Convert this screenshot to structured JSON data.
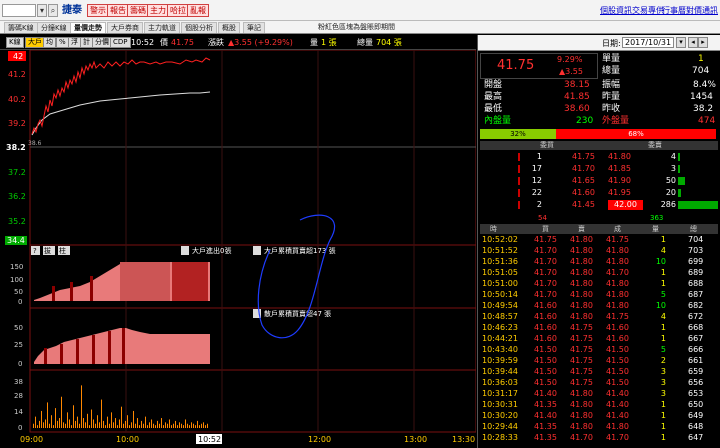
{
  "topbar": {
    "code_value": "",
    "stock_name": "捷泰",
    "buttons": [
      "警示",
      "報告",
      "籌碼",
      "主力",
      "哈拉",
      "亂報"
    ],
    "links": [
      "個股資訊",
      "交易專供",
      "行事曆",
      "對價通訊"
    ]
  },
  "tabs": [
    "籌碼K線",
    "分鐘K線",
    "量價走勢",
    "大戶券商",
    "主力軌道",
    "個股分析",
    "概股",
    "筆記"
  ],
  "tab_title": "粉紅色區塊為盤賬即期間",
  "toolbar": {
    "buttons": [
      "K線",
      "大戶",
      "均",
      "%",
      "浮",
      "計",
      "分價",
      "CDP"
    ],
    "time": "10:52",
    "price_label": "價",
    "price": "41.75",
    "change_label": "漲跌",
    "change": "▲3.55 (+9.29%)",
    "vol_label": "量",
    "vol": "1 張",
    "total_label": "總量",
    "total": "704 張"
  },
  "chart": {
    "price_axis": [
      "42",
      "41.2",
      "40.2",
      "39.2",
      "38.2",
      "37.2",
      "36.2",
      "35.2",
      "34.4"
    ],
    "ref_price": "38.2",
    "low_price": "38.6",
    "big_label": "大戶進出0張",
    "retail_label": "大戶累積買賣超173 張",
    "retail2_label": "散戶累積買賣超47 張",
    "vol_axis1": [
      "150",
      "100",
      "50",
      "0"
    ],
    "vol_axis2": [
      "50",
      "25",
      "0"
    ],
    "vol_axis3": [
      "38",
      "28",
      "14",
      "0"
    ],
    "time_axis": [
      "09:00",
      "10:00",
      "10:52",
      "12:00",
      "13:00",
      "13:30"
    ],
    "small_btns": [
      "?",
      "拔",
      "柱"
    ]
  },
  "right": {
    "date_label": "日期:",
    "date_value": "2017/10/31",
    "price": "41.75",
    "pct": "9.29%",
    "chg": "▲3.55",
    "summary": [
      [
        "單量",
        "1"
      ],
      [
        "總量",
        "704"
      ],
      [
        "開盤",
        "38.15"
      ],
      [
        "振幅",
        "8.4%"
      ],
      [
        "最高",
        "41.85"
      ],
      [
        "昨量",
        "1454"
      ],
      [
        "最低",
        "38.60"
      ],
      [
        "昨收",
        "38.2"
      ],
      [
        "內盤量",
        "230"
      ],
      [
        "外盤量",
        "474"
      ]
    ],
    "ratio_in": "32%",
    "ratio_out": "68%",
    "book_buy_hdr": "委買",
    "book_sell_hdr": "委賣",
    "book": [
      [
        "1",
        "41.75",
        "41.80",
        "4"
      ],
      [
        "17",
        "41.70",
        "41.85",
        "3"
      ],
      [
        "12",
        "41.65",
        "41.90",
        "50"
      ],
      [
        "22",
        "41.60",
        "41.95",
        "20"
      ],
      [
        "2",
        "41.45",
        "42.00",
        "286"
      ]
    ],
    "book_totals": [
      "54",
      "363"
    ],
    "tick_headers": [
      "時",
      "買",
      "賣",
      "成",
      "量",
      "總"
    ],
    "ticks": [
      [
        "10:52:02",
        "41.75",
        "41.80",
        "41.75",
        "1",
        "704"
      ],
      [
        "10:51:52",
        "41.70",
        "41.80",
        "41.80",
        "4",
        "703"
      ],
      [
        "10:51:36",
        "41.70",
        "41.80",
        "41.80",
        "10",
        "699"
      ],
      [
        "10:51:05",
        "41.70",
        "41.80",
        "41.70",
        "1",
        "689"
      ],
      [
        "10:51:00",
        "41.70",
        "41.80",
        "41.80",
        "1",
        "688"
      ],
      [
        "10:50:14",
        "41.70",
        "41.80",
        "41.80",
        "5",
        "687"
      ],
      [
        "10:49:54",
        "41.60",
        "41.80",
        "41.80",
        "10",
        "682"
      ],
      [
        "10:48:57",
        "41.60",
        "41.80",
        "41.75",
        "4",
        "672"
      ],
      [
        "10:46:23",
        "41.60",
        "41.75",
        "41.60",
        "1",
        "668"
      ],
      [
        "10:44:21",
        "41.60",
        "41.75",
        "41.60",
        "1",
        "667"
      ],
      [
        "10:43:40",
        "41.50",
        "41.75",
        "41.50",
        "5",
        "666"
      ],
      [
        "10:39:59",
        "41.50",
        "41.75",
        "41.50",
        "2",
        "661"
      ],
      [
        "10:39:44",
        "41.50",
        "41.75",
        "41.50",
        "3",
        "659"
      ],
      [
        "10:36:03",
        "41.50",
        "41.75",
        "41.50",
        "3",
        "656"
      ],
      [
        "10:31:17",
        "41.40",
        "41.80",
        "41.40",
        "3",
        "653"
      ],
      [
        "10:30:31",
        "41.35",
        "41.80",
        "41.40",
        "1",
        "650"
      ],
      [
        "10:30:20",
        "41.40",
        "41.80",
        "41.40",
        "1",
        "649"
      ],
      [
        "10:29:44",
        "41.35",
        "41.80",
        "41.80",
        "1",
        "648"
      ],
      [
        "10:28:33",
        "41.35",
        "41.70",
        "41.70",
        "1",
        "647"
      ]
    ]
  }
}
